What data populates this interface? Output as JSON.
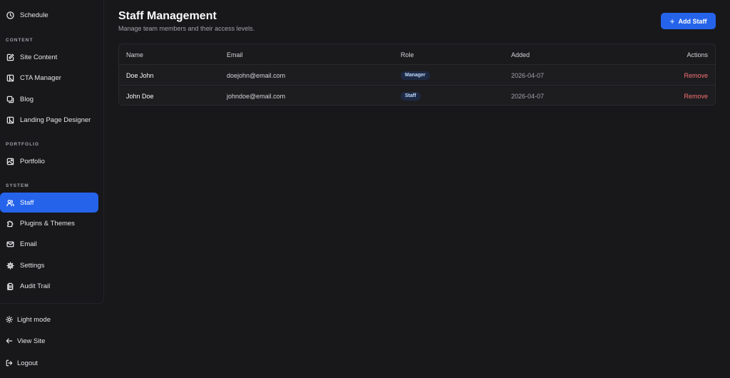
{
  "sidebar": {
    "top_item": {
      "label": "Schedule",
      "icon": "clock-icon"
    },
    "sections": {
      "content": "CONTENT",
      "portfolio": "PORTFOLIO",
      "system": "SYSTEM"
    },
    "content_items": [
      {
        "label": "Site Content",
        "icon": "edit-icon"
      },
      {
        "label": "CTA Manager",
        "icon": "layout-icon"
      },
      {
        "label": "Blog",
        "icon": "copy-icon"
      },
      {
        "label": "Landing Page Designer",
        "icon": "layout-icon"
      }
    ],
    "portfolio_items": [
      {
        "label": "Portfolio",
        "icon": "image-icon"
      }
    ],
    "system_items": [
      {
        "label": "Staff",
        "icon": "users-icon",
        "active": true
      },
      {
        "label": "Plugins & Themes",
        "icon": "puzzle-icon"
      },
      {
        "label": "Email",
        "icon": "mail-icon"
      },
      {
        "label": "Settings",
        "icon": "gear-icon"
      },
      {
        "label": "Audit Trail",
        "icon": "file-icon"
      }
    ],
    "bottom_items": [
      {
        "label": "Light mode",
        "icon": "sun-icon"
      },
      {
        "label": "View Site",
        "icon": "arrow-left-icon"
      },
      {
        "label": "Logout",
        "icon": "logout-icon"
      }
    ]
  },
  "header": {
    "title": "Staff Management",
    "subtitle": "Manage team members and their access levels.",
    "add_button": "Add Staff"
  },
  "table": {
    "columns": [
      "Name",
      "Email",
      "Role",
      "Added",
      "Actions"
    ],
    "rows": [
      {
        "name": "Doe John",
        "email": "doejohn@email.com",
        "role": "Manager",
        "added": "2026-04-07",
        "action": "Remove"
      },
      {
        "name": "John Doe",
        "email": "johndoe@email.com",
        "role": "Staff",
        "added": "2026-04-07",
        "action": "Remove"
      }
    ]
  },
  "colors": {
    "accent": "#2563eb",
    "background": "#18181b",
    "danger": "#f87171"
  }
}
